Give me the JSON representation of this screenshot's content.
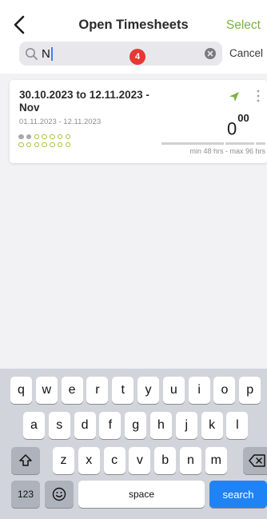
{
  "nav": {
    "title": "Open Timesheets",
    "select": "Select"
  },
  "search": {
    "value": "N",
    "badge": "4",
    "cancel": "Cancel"
  },
  "timesheet": {
    "title": "30.10.2023 to 12.11.2023 - Nov",
    "dates": "01.11.2023 - 12.11.2023",
    "hours_main": "0",
    "hours_sup": "00",
    "range": "min 48 hrs - max 96 hrs",
    "day_dots": {
      "row1": [
        "filled",
        "filled",
        "open",
        "open",
        "open",
        "open",
        "open"
      ],
      "row2": [
        "open",
        "open",
        "open",
        "open",
        "open",
        "open",
        "open"
      ]
    },
    "accent_color": "#a7c02d"
  },
  "keyboard": {
    "row1": [
      "q",
      "w",
      "e",
      "r",
      "t",
      "y",
      "u",
      "i",
      "o",
      "p"
    ],
    "row2": [
      "a",
      "s",
      "d",
      "f",
      "g",
      "h",
      "j",
      "k",
      "l"
    ],
    "row3": [
      "z",
      "x",
      "c",
      "v",
      "b",
      "n",
      "m"
    ],
    "numbers": "123",
    "space": "space",
    "search": "search"
  },
  "icons": [
    "back-chevron-icon",
    "search-icon",
    "clear-icon",
    "send-icon",
    "more-icon",
    "shift-icon",
    "delete-icon",
    "emoji-icon"
  ]
}
